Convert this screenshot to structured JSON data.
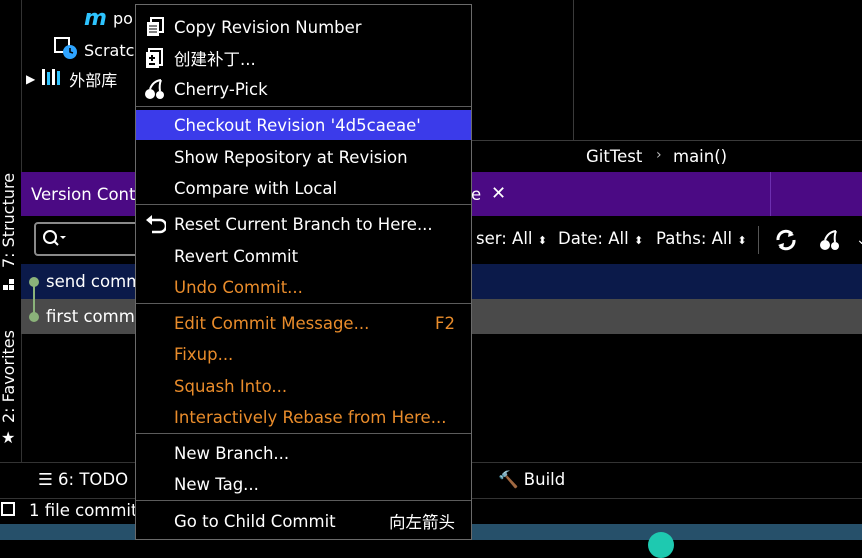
{
  "tree": {
    "item1_label": "po",
    "item2_label": "Scratch",
    "item3_label": "外部库"
  },
  "left_strip": {
    "structure_label": "7: Structure",
    "favorites_label": "2: Favorites"
  },
  "editor": {
    "breadcrumb_project": "GitTest",
    "breadcrumb_sep": "›",
    "breadcrumb_method": "main()"
  },
  "version_control": {
    "tab_label": "Version Cont",
    "tab_fragment": "e",
    "filters": {
      "user": "ser: All",
      "date": "Date: All",
      "paths": "Paths: All"
    },
    "commits": [
      {
        "message": "send comm"
      },
      {
        "message": "first comm"
      }
    ]
  },
  "bottom": {
    "todo_label": "6: TODO",
    "build_label": "Build"
  },
  "status": {
    "text": "1 file commit"
  },
  "context_menu": {
    "items": [
      {
        "label": "Copy Revision Number",
        "icon": "copy-icon"
      },
      {
        "label": "创建补丁...",
        "icon": "patch-icon"
      },
      {
        "label": "Cherry-Pick",
        "icon": "cherry-icon"
      },
      {
        "label": "Checkout Revision '4d5caeae'",
        "selected": true
      },
      {
        "label": "Show Repository at Revision"
      },
      {
        "label": "Compare with Local"
      },
      {
        "label": "Reset Current Branch to Here...",
        "icon": "undo-icon"
      },
      {
        "label": "Revert Commit"
      },
      {
        "label": "Undo Commit...",
        "disabled": true
      },
      {
        "label": "Edit Commit Message...",
        "shortcut": "F2",
        "disabled": true
      },
      {
        "label": "Fixup...",
        "disabled": true
      },
      {
        "label": "Squash Into...",
        "disabled": true
      },
      {
        "label": "Interactively Rebase from Here...",
        "disabled": true
      },
      {
        "label": "New Branch..."
      },
      {
        "label": "New Tag..."
      },
      {
        "label": "Go to Child Commit",
        "shortcut": "向左箭头"
      }
    ]
  },
  "colors": {
    "selection": "#3b3bea",
    "header_purple": "#4b0a84",
    "disabled_orange": "#e98c2b",
    "selected_row": "#0b1a4a",
    "current_row": "#4a4a4a"
  }
}
